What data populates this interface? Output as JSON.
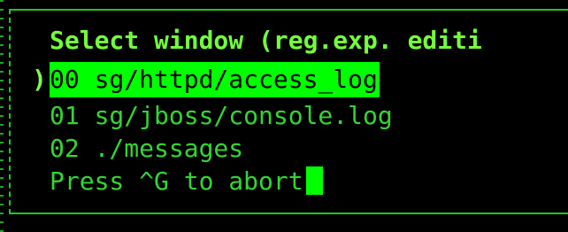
{
  "window_select": {
    "title": "Select window (reg.exp. editi",
    "selected_item": "00 sg/httpd/access_log",
    "items": [
      "01 sg/jboss/console.log",
      "02 ./messages"
    ],
    "prompt": "Press ^G to abort",
    "selection_marker": ")"
  },
  "colors": {
    "background": "#000000",
    "text": "#33d633",
    "highlight": "#00ff00",
    "title": "#73ff3a",
    "border": "#22c622"
  }
}
